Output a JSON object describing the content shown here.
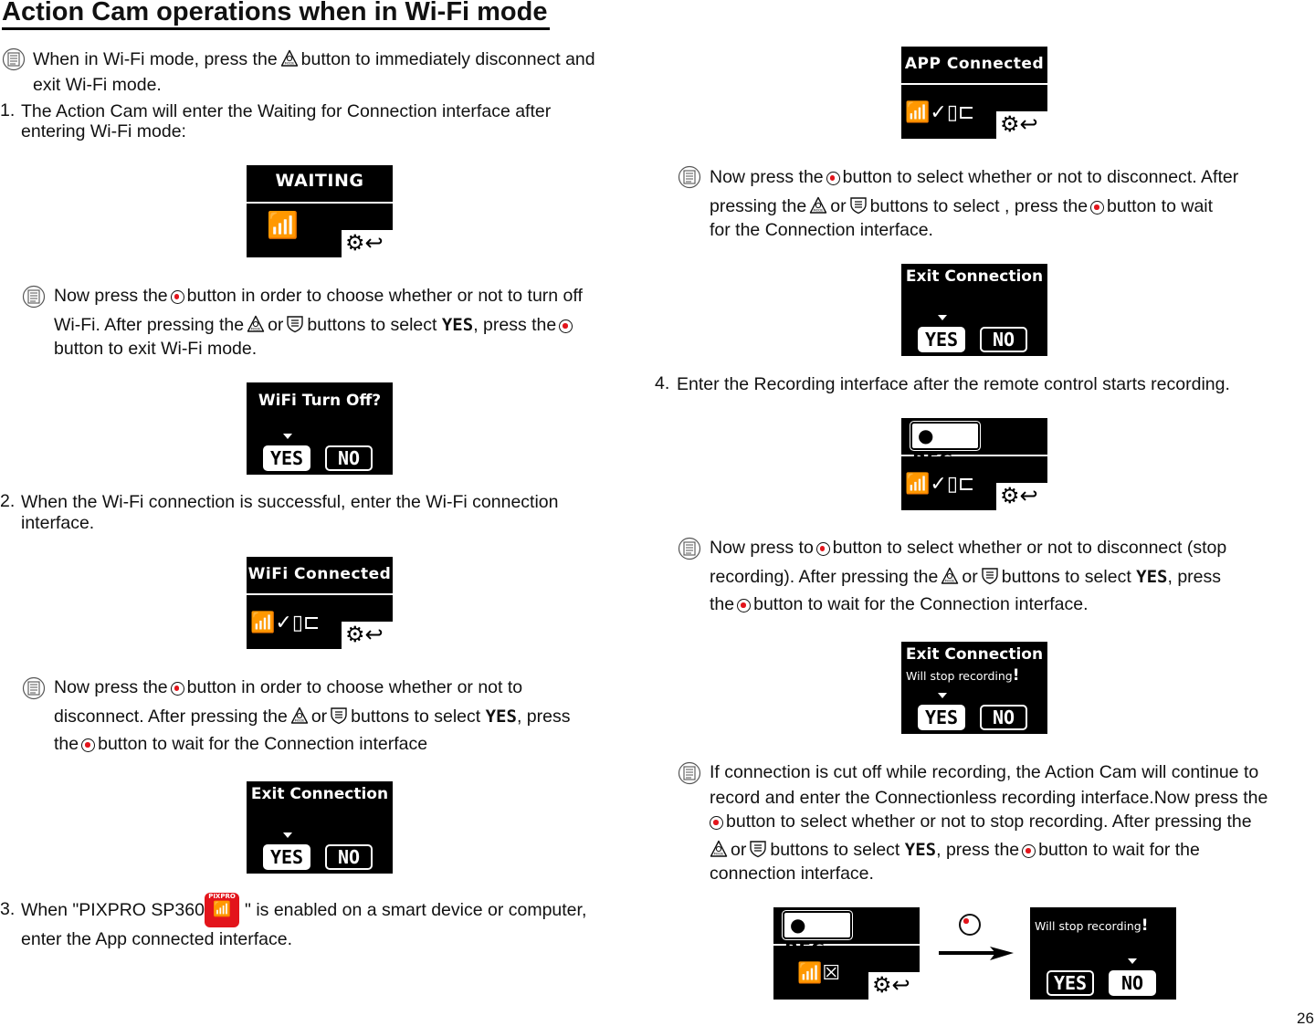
{
  "title": "Action Cam operations when in Wi-Fi mode",
  "intro": {
    "a": "When in Wi-Fi mode, press the",
    "b": "button to immediately disconnect and",
    "c": "exit Wi-Fi mode."
  },
  "step1": {
    "num": "1.",
    "a": "The Action Cam will enter the Waiting for Connection interface after",
    "b": "entering Wi-Fi mode:"
  },
  "note1": {
    "a": "Now press the",
    "b": "button in order to choose whether or not to turn off",
    "c": "Wi-Fi. After pressing the",
    "d": "or",
    "e": "buttons to select",
    "f": ", press the",
    "g": "button to exit Wi-Fi mode."
  },
  "step2": {
    "num": "2.",
    "a": "When the Wi-Fi connection is successful, enter the Wi-Fi connection",
    "b": "interface."
  },
  "note2": {
    "a": "Now press the",
    "b": "button in order to choose whether or not to",
    "c": "disconnect. After pressing the",
    "d": "or",
    "e": "buttons to select",
    "f": ", press",
    "g": "the",
    "h": "button to wait for the Connection interface"
  },
  "step3": {
    "num": "3.",
    "a": "When \"PIXPRO SP360",
    "b": "\" is enabled on a smart device or computer,",
    "c": "enter the App connected interface.",
    "app_icon_text": "PIXPRO"
  },
  "note3": {
    "a": "Now press the",
    "b": "button to select whether or not to disconnect. After",
    "c": "pressing the",
    "d": "or",
    "e": "buttons to select  , press the",
    "f": "button to wait",
    "g": "for the Connection interface."
  },
  "step4": {
    "num": "4.",
    "a": "Enter the Recording interface after the remote control starts recording."
  },
  "note4": {
    "a": "Now press to",
    "b": "button to select whether or not to disconnect (stop",
    "c": "recording). After pressing the",
    "d": "or",
    "e": "buttons to select",
    "f": ", press",
    "g": "the",
    "h": "button to wait for the Connection interface."
  },
  "note5": {
    "a": "If connection is cut off while recording, the Action Cam will continue to",
    "b": "record and enter the Connectionless recording interface.Now press the",
    "c": "button to select whether or not to stop recording. After pressing the",
    "d": "or",
    "e": "buttons to select",
    "f": ", press the",
    "g": "button to wait for the",
    "h": "connection interface."
  },
  "yes_word": "YES",
  "screens": {
    "waiting": "WAITING",
    "wifi_off": "WiFi Turn Off?",
    "wifi_connected": "WiFi Connected",
    "exit_connection": "Exit Connection",
    "app_connected": "APP Connected",
    "rec": "REC",
    "will_stop": "Will stop recording",
    "exclaim": "!",
    "yes": "YES",
    "no": "NO"
  },
  "colors": {
    "ok_dot": "#e3141b",
    "app_icon": "#e3141b"
  },
  "page_number": "26"
}
